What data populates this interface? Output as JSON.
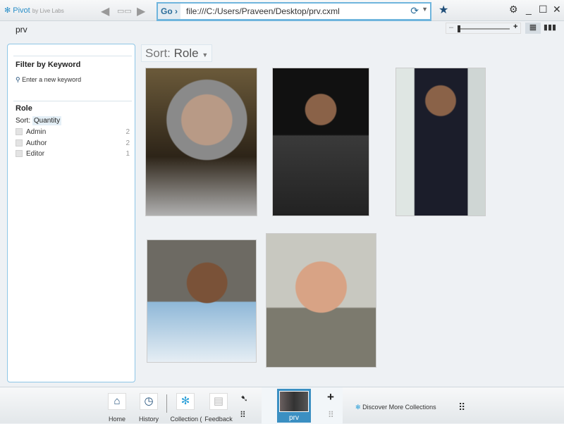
{
  "app": {
    "name": "Pivot",
    "by": "by Live Labs"
  },
  "address": {
    "go": "Go ›",
    "url": "file:///C:/Users/Praveen/Desktop/prv.cxml"
  },
  "breadcrumb": "prv",
  "zoom": {
    "minus": "–",
    "plus": "+",
    "level": 0.05
  },
  "panel": {
    "filter_title": "Filter by Keyword",
    "keyword_placeholder": "Enter a new keyword",
    "facet_title": "Role",
    "sort_label": "Sort:",
    "sort_value": "Quantity",
    "items": [
      {
        "label": "Admin",
        "count": "2"
      },
      {
        "label": "Author",
        "count": "2"
      },
      {
        "label": "Editor",
        "count": "1"
      }
    ]
  },
  "sort": {
    "label": "Sort:",
    "value": "Role"
  },
  "dock": {
    "home": "Home",
    "history": "History",
    "collection": "Collection (",
    "feedback": "Feedback",
    "current": "prv",
    "discover": "Discover More Collections"
  }
}
